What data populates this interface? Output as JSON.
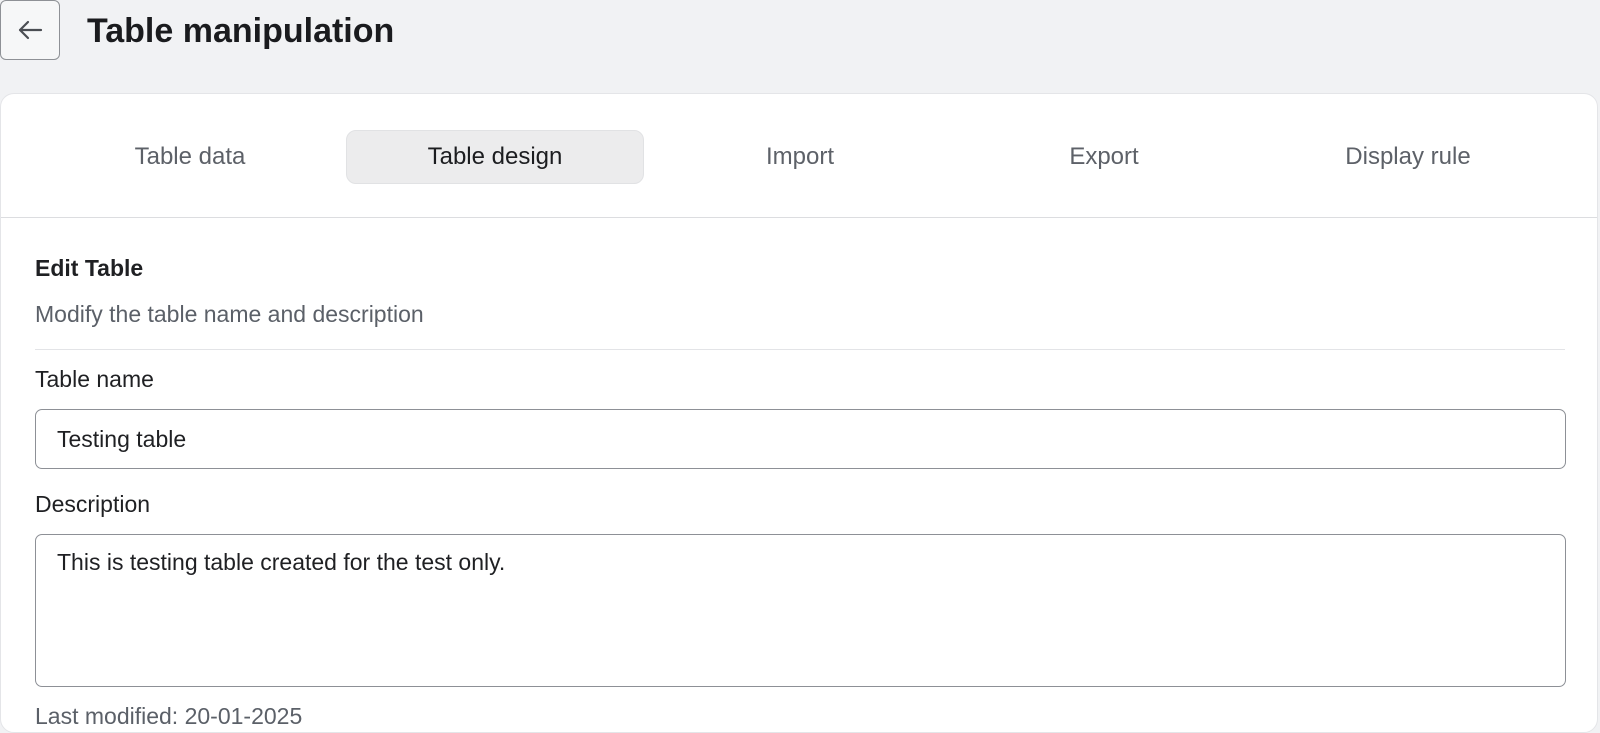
{
  "header": {
    "title": "Table manipulation",
    "back_icon": "arrow-left-icon"
  },
  "tabs": [
    {
      "label": "Table data",
      "active": false
    },
    {
      "label": "Table design",
      "active": true
    },
    {
      "label": "Import",
      "active": false
    },
    {
      "label": "Export",
      "active": false
    },
    {
      "label": "Display rule",
      "active": false
    }
  ],
  "edit_section": {
    "title": "Edit Table",
    "subtitle": "Modify the table name and description",
    "name_label": "Table name",
    "name_value": "Testing table",
    "description_label": "Description",
    "description_value": "This is testing table created for the test only.",
    "last_modified": "Last modified: 20-01-2025"
  },
  "colors": {
    "page_background": "#f1f2f4",
    "card_background": "#ffffff",
    "active_tab_background": "#ececed",
    "input_border": "#8d9096"
  }
}
